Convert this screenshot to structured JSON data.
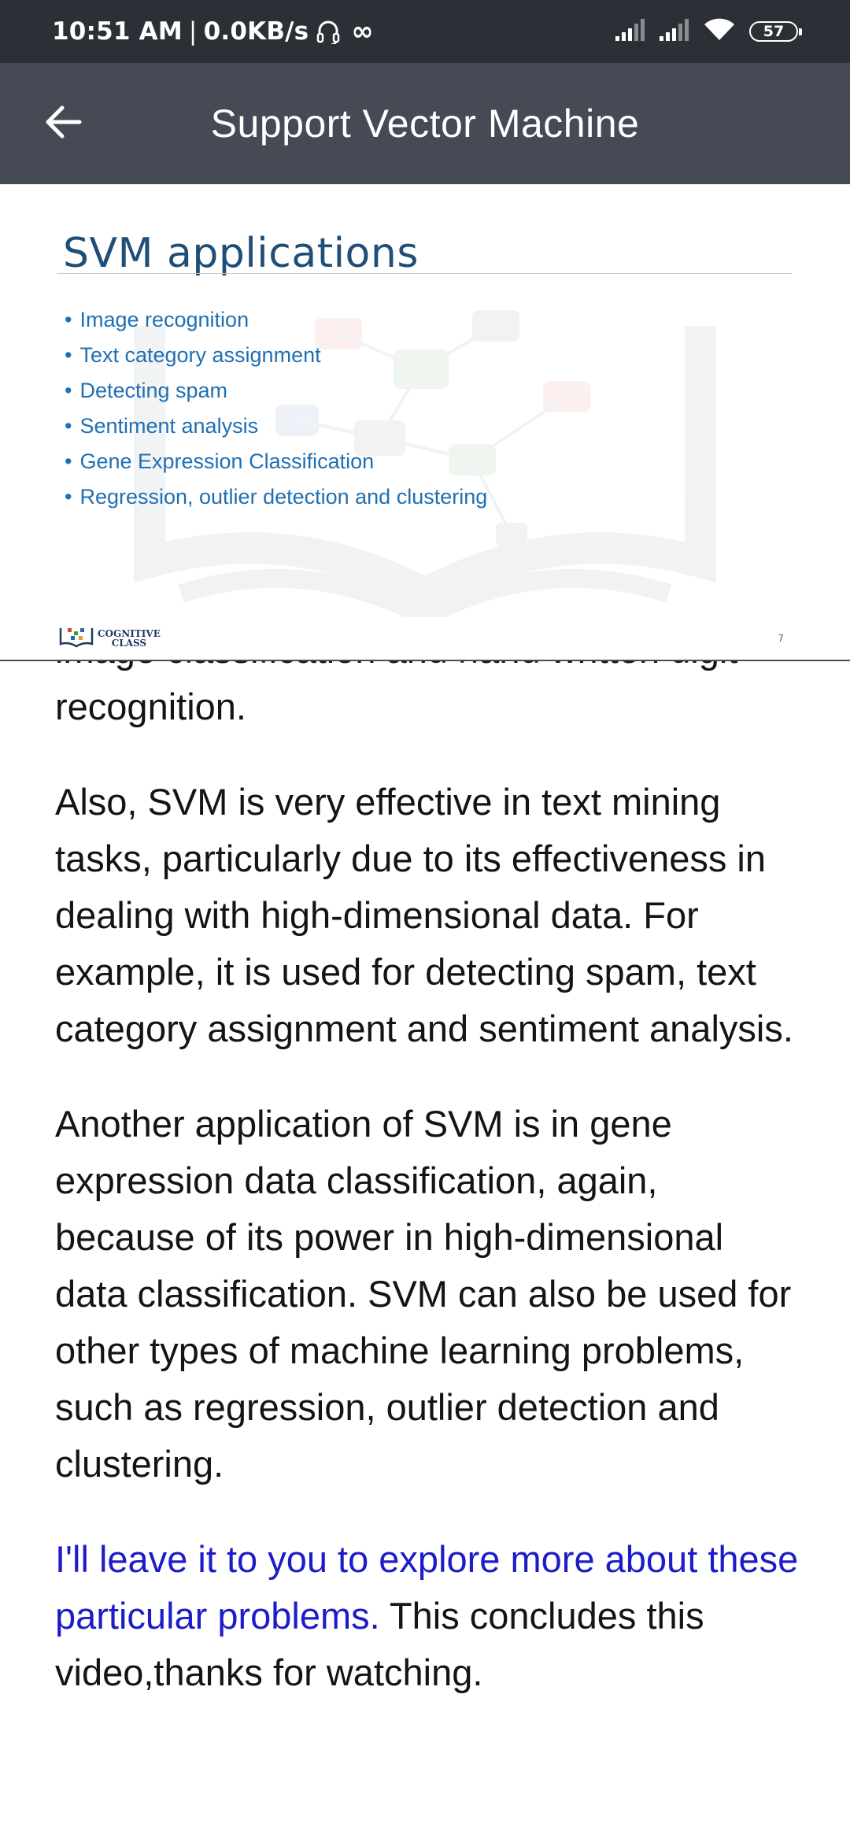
{
  "status_bar": {
    "time": "10:51 AM",
    "separator": "|",
    "network_speed": "0.0KB/s",
    "infinity_symbol": "∞",
    "battery_level": "57",
    "icons": [
      "headset-icon",
      "infinity-icon",
      "signal-icon",
      "signal-icon",
      "wifi-icon",
      "battery-icon"
    ]
  },
  "app_bar": {
    "title": "Support Vector Machine",
    "back_icon": "arrow-left-icon"
  },
  "slide": {
    "title": "SVM applications",
    "bullets": [
      "Image recognition",
      "Text category assignment",
      "Detecting spam",
      "Sentiment analysis",
      "Gene Expression Classification",
      "Regression, outlier detection and clustering"
    ],
    "logo_line1": "COGNITIVE",
    "logo_line2": "CLASS",
    "page_number": "7",
    "colors": {
      "title": "#1f4e79",
      "bullets": "#1f6fb2"
    }
  },
  "transcript": {
    "paragraph1": "image classification and hand written digit recognition.",
    "paragraph2": "Also, SVM is very effective in text mining tasks, particularly due to its effectiveness in dealing with high-dimensional data. For example, it is used for detecting spam, text category assignment and sentiment analysis.",
    "paragraph3": "Another application of SVM is in gene expression data classification, again, because of its power in high-dimensional data classification. SVM can also be used for other types of machine learning problems, such as regression, outlier detection and clustering.",
    "paragraph4_highlight": "I'll leave it to you to explore more about these particular problems.",
    "paragraph4_rest": " This concludes this video,thanks for watching.",
    "colors": {
      "text": "#141414",
      "highlight": "#1c1cc8"
    }
  },
  "colors": {
    "status_bar_bg": "#2b2f36",
    "app_bar_bg": "#454a54"
  }
}
